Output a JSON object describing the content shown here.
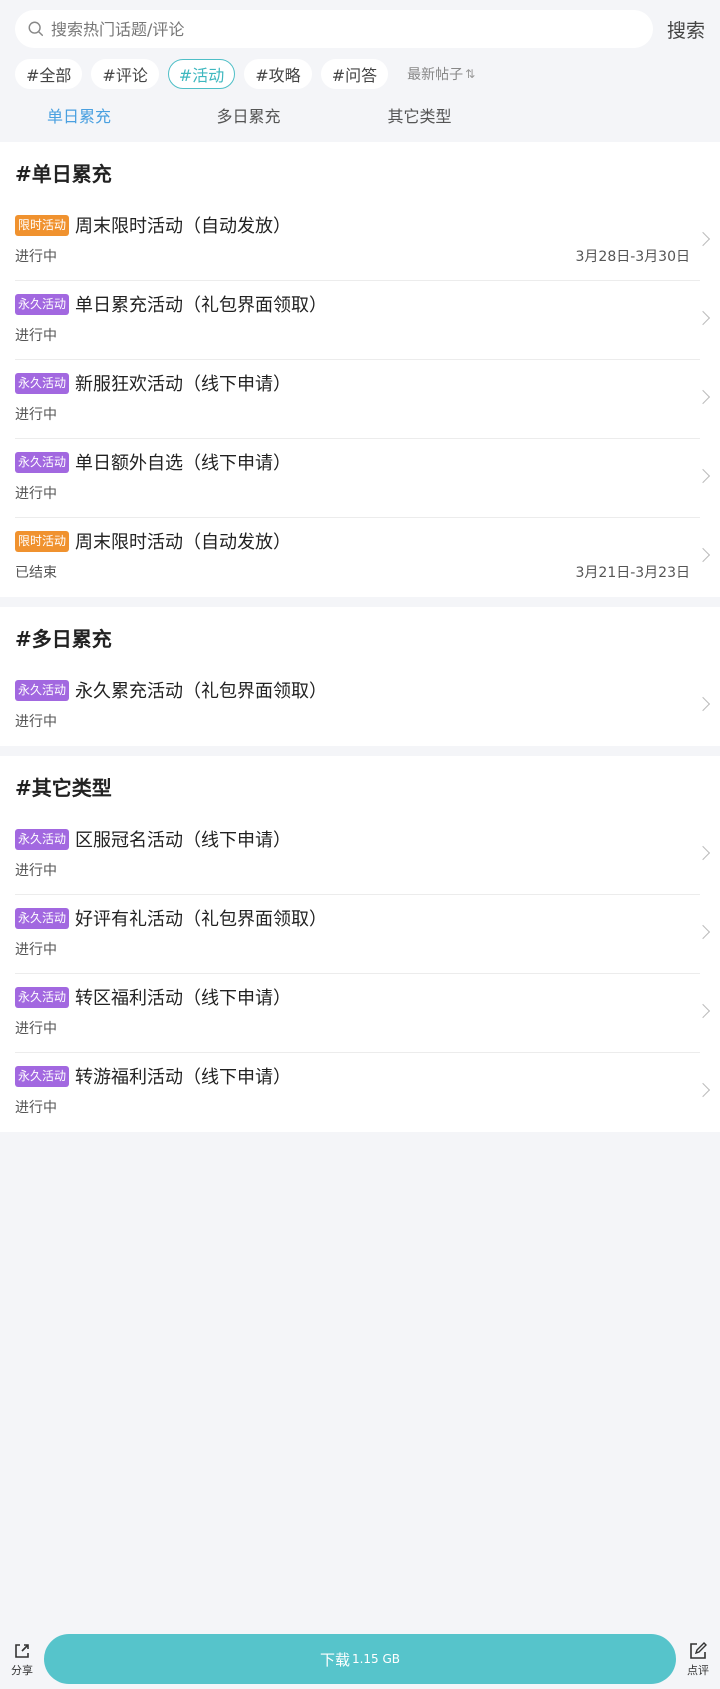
{
  "search": {
    "placeholder": "搜索热门话题/评论",
    "button_label": "搜索"
  },
  "tags": [
    {
      "label": "#全部",
      "active": false
    },
    {
      "label": "#评论",
      "active": false
    },
    {
      "label": "#活动",
      "active": true
    },
    {
      "label": "#攻略",
      "active": false
    },
    {
      "label": "#问答",
      "active": false
    }
  ],
  "sort": {
    "label": "最新帖子",
    "icon": "sort-icon"
  },
  "tabs": [
    {
      "label": "单日累充",
      "active": true
    },
    {
      "label": "多日累充",
      "active": false
    },
    {
      "label": "其它类型",
      "active": false
    }
  ],
  "sections": [
    {
      "title": "#单日累充",
      "items": [
        {
          "badge": "限时活动",
          "badge_type": "limited",
          "title": "周末限时活动（自动发放）",
          "status": "进行中",
          "date": "3月28日-3月30日"
        },
        {
          "badge": "永久活动",
          "badge_type": "permanent",
          "title": "单日累充活动（礼包界面领取）",
          "status": "进行中",
          "date": ""
        },
        {
          "badge": "永久活动",
          "badge_type": "permanent",
          "title": "新服狂欢活动（线下申请）",
          "status": "进行中",
          "date": ""
        },
        {
          "badge": "永久活动",
          "badge_type": "permanent",
          "title": "单日额外自选（线下申请）",
          "status": "进行中",
          "date": ""
        },
        {
          "badge": "限时活动",
          "badge_type": "limited",
          "title": "周末限时活动（自动发放）",
          "status": "已结束",
          "date": "3月21日-3月23日"
        }
      ]
    },
    {
      "title": "#多日累充",
      "items": [
        {
          "badge": "永久活动",
          "badge_type": "permanent",
          "title": "永久累充活动（礼包界面领取）",
          "status": "进行中",
          "date": ""
        }
      ]
    },
    {
      "title": "#其它类型",
      "items": [
        {
          "badge": "永久活动",
          "badge_type": "permanent",
          "title": "区服冠名活动（线下申请）",
          "status": "进行中",
          "date": ""
        },
        {
          "badge": "永久活动",
          "badge_type": "permanent",
          "title": "好评有礼活动（礼包界面领取）",
          "status": "进行中",
          "date": ""
        },
        {
          "badge": "永久活动",
          "badge_type": "permanent",
          "title": "转区福利活动（线下申请）",
          "status": "进行中",
          "date": ""
        },
        {
          "badge": "永久活动",
          "badge_type": "permanent",
          "title": "转游福利活动（线下申请）",
          "status": "进行中",
          "date": ""
        }
      ]
    }
  ],
  "bottom": {
    "share_label": "分享",
    "download_label": "下载",
    "download_size": "1.15 GB",
    "review_label": "点评"
  },
  "colors": {
    "accent": "#56c4cb",
    "limited_badge": "#f0922f",
    "permanent_badge": "#a268e0",
    "active_tab": "#4aa0e0"
  }
}
